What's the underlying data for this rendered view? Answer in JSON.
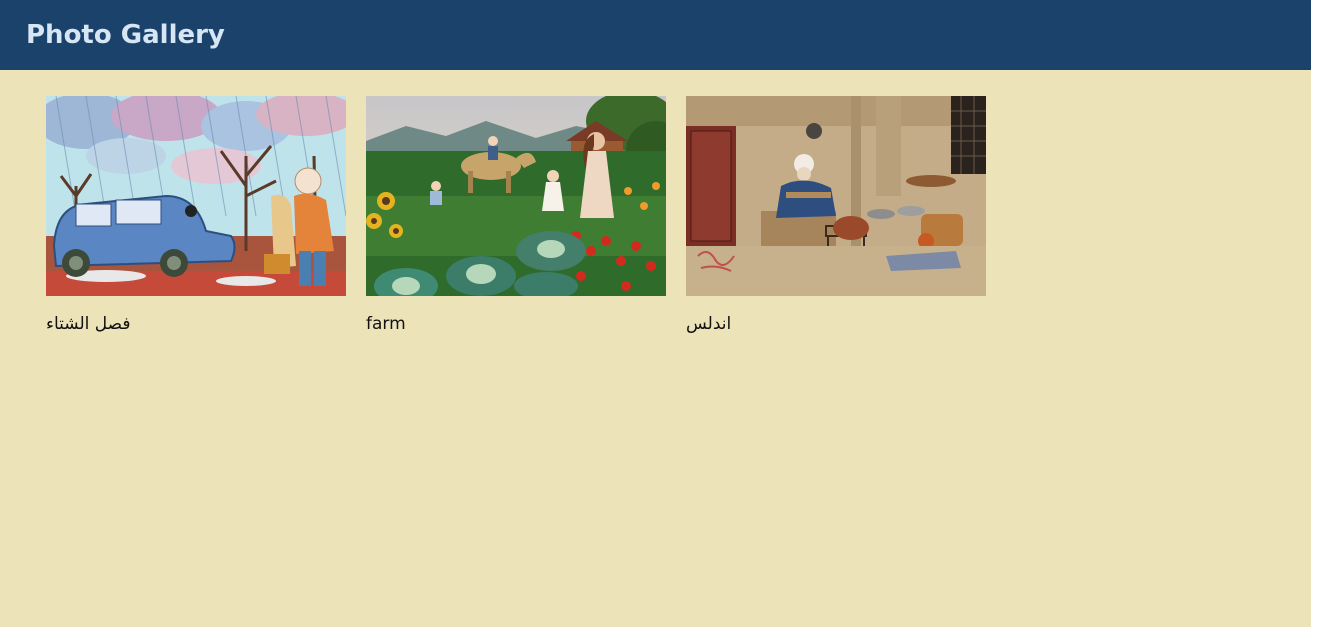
{
  "header": {
    "title": "Photo Gallery"
  },
  "gallery": {
    "items": [
      {
        "caption": "فصل الشتاء",
        "image": "winter-rain-car-painting"
      },
      {
        "caption": "farm",
        "image": "farm-garden-children-painting"
      },
      {
        "caption": "اندلس",
        "image": "andalus-street-merchant-painting"
      }
    ]
  },
  "colors": {
    "header_bg": "#1b426b",
    "title": "#d6e6f5",
    "page_bg": "#ede3b9"
  }
}
